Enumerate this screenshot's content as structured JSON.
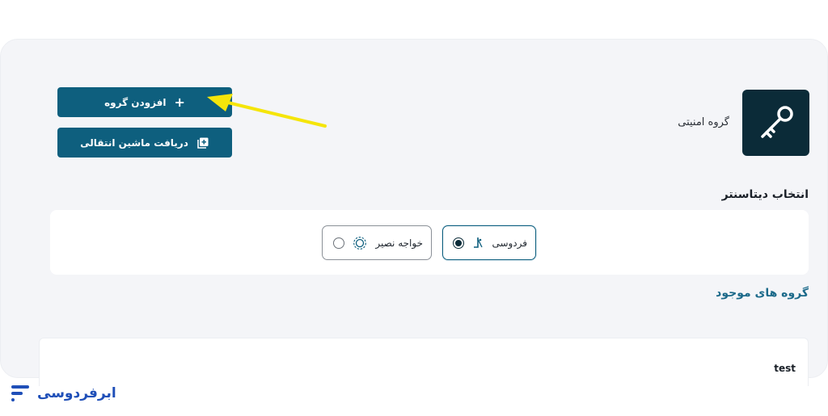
{
  "actions": {
    "add_group_label": "افزودن گروه",
    "transfer_vm_label": "دریافت ماشین انتقالی"
  },
  "security_group": {
    "label": "گروه امنیتی",
    "icon": "key-icon"
  },
  "datacenter": {
    "title": "انتخاب دیتاسنتر",
    "options": [
      {
        "label": "فردوسی",
        "selected": true,
        "icon": "ferdowsi-logo-icon"
      },
      {
        "label": "خواجه نصیر",
        "selected": false,
        "icon": "khajeh-nasir-logo-icon"
      }
    ]
  },
  "existing_groups": {
    "title": "گروه های موجود",
    "rows": [
      {
        "name": "test"
      }
    ]
  },
  "brand": {
    "name": "ابرفردوسی"
  },
  "colors": {
    "primary": "#0e5f7e",
    "dark": "#0b2b38",
    "highlight_arrow": "#f5e50a",
    "brand": "#1f4fb8"
  }
}
